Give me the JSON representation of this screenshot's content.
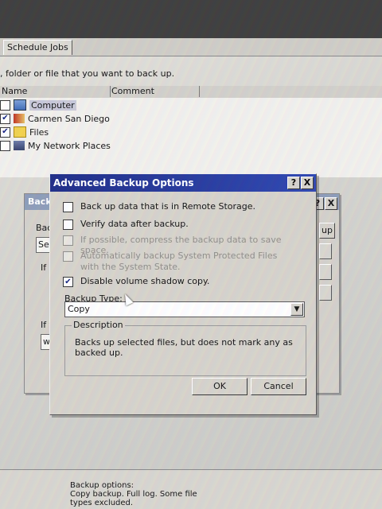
{
  "backup_window": {
    "tabs": [
      {
        "label": "Schedule Jobs"
      }
    ],
    "instruction": ", folder or file that you want to back up.",
    "columns": {
      "name": "Name",
      "comment": "Comment"
    },
    "tree": [
      {
        "label": "Computer",
        "checked": false,
        "icon": "computer-icon"
      },
      {
        "label": "Carmen San Diego",
        "checked": true,
        "icon": "user-folder-icon"
      },
      {
        "label": "Files",
        "checked": true,
        "icon": "folder-icon"
      },
      {
        "label": "My Network Places",
        "checked": false,
        "icon": "network-places-icon"
      }
    ],
    "bottom_panel": {
      "heading": "Backup options:",
      "line1": "Copy backup.  Full log.  Some file",
      "line2": "types excluded."
    }
  },
  "back_dialog": {
    "title_fragment": "Back",
    "field1": "Back",
    "field2": "Set",
    "group_prefix": "If",
    "label_if": "If th",
    "combo": "whi",
    "button_fragment": "up"
  },
  "dialog": {
    "title": "Advanced Backup Options",
    "help_btn": "?",
    "close_btn": "X",
    "options": [
      {
        "label": "Back up data that is in Remote Storage.",
        "checked": false,
        "disabled": false
      },
      {
        "label": "Verify data after backup.",
        "checked": false,
        "disabled": false
      },
      {
        "label": "If possible, compress the backup data to save space.",
        "checked": false,
        "disabled": true
      },
      {
        "label": "Automatically backup System Protected Files with the System State.",
        "checked": false,
        "disabled": true
      },
      {
        "label": "Disable volume shadow copy.",
        "checked": true,
        "disabled": false
      }
    ],
    "backup_type_label": "Backup Type:",
    "backup_type_value": "Copy",
    "description_legend": "Description",
    "description_text": "Backs up selected files, but does not mark any as backed up.",
    "ok": "OK",
    "cancel": "Cancel"
  },
  "colors": {
    "titlebar": "#1b2a86",
    "face": "#d6d3cb"
  }
}
